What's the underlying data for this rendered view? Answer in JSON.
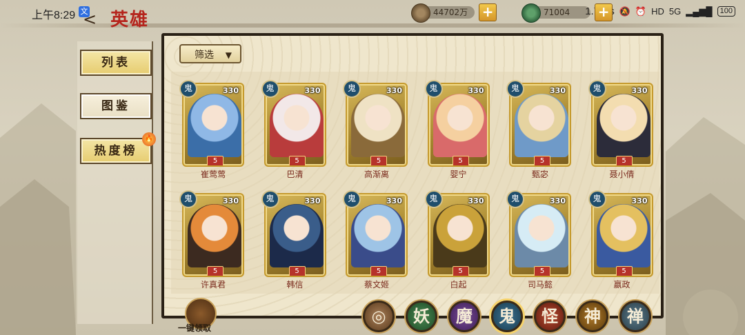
{
  "status_bar": {
    "time": "上午8:29",
    "app_badge": "文",
    "speed": "1.7K/s",
    "network": "5G",
    "battery": "100"
  },
  "header": {
    "title": "英雄"
  },
  "currencies": [
    {
      "name": "coin",
      "value": "44702万"
    },
    {
      "name": "jade",
      "value": "71004"
    }
  ],
  "sidebar": {
    "items": [
      {
        "label": "列表"
      },
      {
        "label": "图鉴"
      },
      {
        "label": "热度榜"
      }
    ]
  },
  "filter": {
    "label": "筛选"
  },
  "heroes": [
    {
      "name": "崔莺莺",
      "power": "330",
      "faction": "鬼",
      "stars": "5"
    },
    {
      "name": "巴清",
      "power": "330",
      "faction": "鬼",
      "stars": "5"
    },
    {
      "name": "高渐离",
      "power": "330",
      "faction": "鬼",
      "stars": "5"
    },
    {
      "name": "婴宁",
      "power": "330",
      "faction": "鬼",
      "stars": "5"
    },
    {
      "name": "甄宓",
      "power": "330",
      "faction": "鬼",
      "stars": "5"
    },
    {
      "name": "聂小倩",
      "power": "330",
      "faction": "鬼",
      "stars": "5"
    },
    {
      "name": "许真君",
      "power": "330",
      "faction": "鬼",
      "stars": "5"
    },
    {
      "name": "韩信",
      "power": "330",
      "faction": "鬼",
      "stars": "5"
    },
    {
      "name": "蔡文姬",
      "power": "330",
      "faction": "鬼",
      "stars": "5"
    },
    {
      "name": "白起",
      "power": "330",
      "faction": "鬼",
      "stars": "5"
    },
    {
      "name": "司马懿",
      "power": "330",
      "faction": "鬼",
      "stars": "5"
    },
    {
      "name": "嬴政",
      "power": "330",
      "faction": "鬼",
      "stars": "5"
    }
  ],
  "bottom": {
    "collect_label": "一键领取",
    "faction_tabs": [
      {
        "label": "",
        "icon": "all-faction-icon"
      },
      {
        "label": "妖"
      },
      {
        "label": "魔"
      },
      {
        "label": "鬼"
      },
      {
        "label": "怪"
      },
      {
        "label": "神"
      },
      {
        "label": "禅"
      }
    ]
  }
}
